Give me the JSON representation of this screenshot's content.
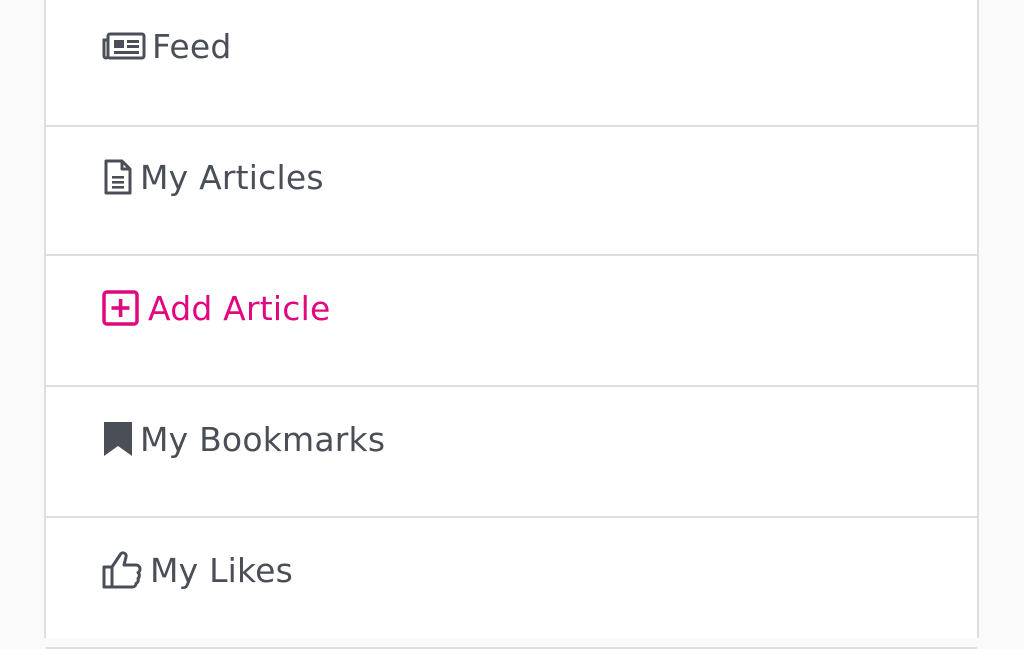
{
  "menu": {
    "items": [
      {
        "label": "Feed",
        "icon": "newspaper-icon",
        "active": false
      },
      {
        "label": "My Articles",
        "icon": "document-icon",
        "active": false
      },
      {
        "label": "Add Article",
        "icon": "plus-square-icon",
        "active": true
      },
      {
        "label": "My Bookmarks",
        "icon": "bookmark-icon",
        "active": false
      },
      {
        "label": "My Likes",
        "icon": "thumbs-up-icon",
        "active": false
      }
    ]
  },
  "colors": {
    "text": "#4a4f57",
    "accent": "#e0087f",
    "border": "#dedede",
    "background": "#fafafa"
  }
}
